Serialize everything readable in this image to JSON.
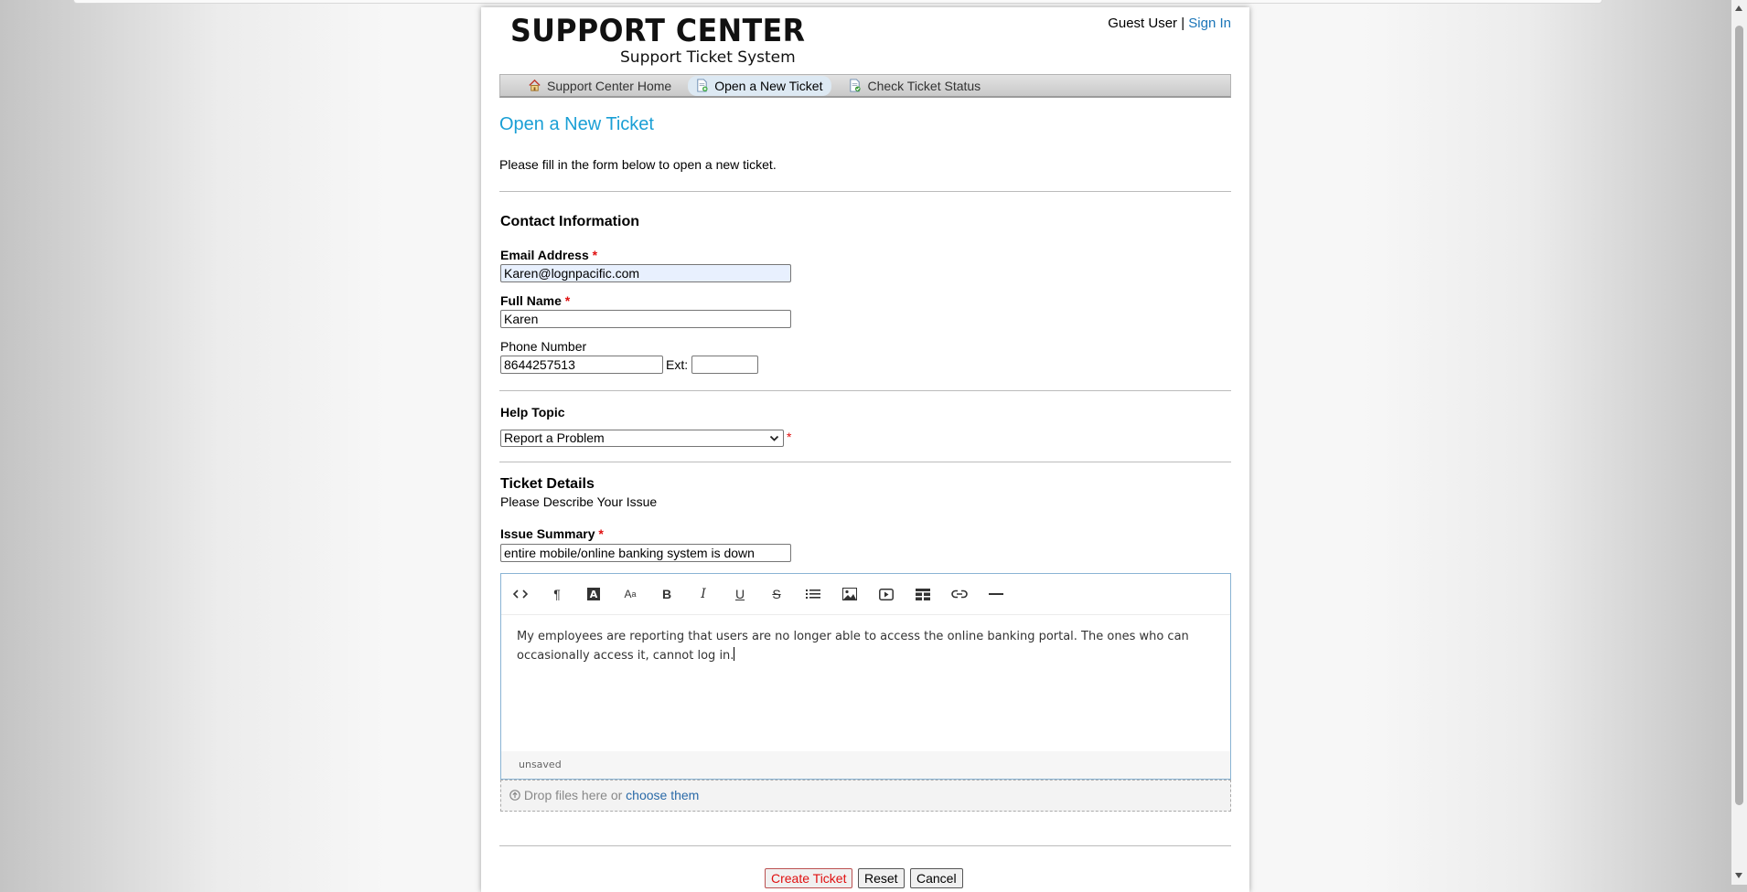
{
  "header": {
    "logo_main": "SUPPORT CENTER",
    "logo_sub": "Support Ticket System",
    "user_label": "Guest User",
    "separator": "|",
    "sign_in": "Sign In"
  },
  "nav": {
    "items": [
      {
        "label": "Support Center Home",
        "icon": "home-icon"
      },
      {
        "label": "Open a New Ticket",
        "icon": "new-ticket-icon"
      },
      {
        "label": "Check Ticket Status",
        "icon": "ticket-status-icon"
      }
    ],
    "active": "Open a New Ticket"
  },
  "page": {
    "title": "Open a New Ticket",
    "intro": "Please fill in the form below to open a new ticket."
  },
  "contact": {
    "title": "Contact Information",
    "email_label": "Email Address",
    "email_value": "Karen@lognpacific.com",
    "name_label": "Full Name",
    "name_value": "Karen",
    "phone_label": "Phone Number",
    "phone_value": "8644257513",
    "ext_label": "Ext:",
    "ext_value": "",
    "required_mark": "*"
  },
  "help_topic": {
    "title": "Help Topic",
    "selected": "Report a Problem"
  },
  "details": {
    "title": "Ticket Details",
    "subtitle": "Please Describe Your Issue",
    "summary_label": "Issue Summary",
    "summary_value": "entire mobile/online banking system is down",
    "body_line1": "My employees are reporting that users are no longer able to access the online banking portal. The ones who can",
    "body_line2": "occasionally access it, cannot log in.",
    "status": "unsaved",
    "toolbar": [
      "code-view-icon",
      "paragraph-icon",
      "text-color-icon",
      "font-size-icon",
      "bold-icon",
      "italic-icon",
      "underline-icon",
      "strikethrough-icon",
      "list-icon",
      "image-icon",
      "video-icon",
      "table-icon",
      "link-icon",
      "horizontal-rule-icon"
    ]
  },
  "attachments": {
    "drop_text": "Drop files here or",
    "choose_link": "choose them"
  },
  "actions": {
    "create": "Create Ticket",
    "reset": "Reset",
    "cancel": "Cancel"
  },
  "colors": {
    "accent": "#1a9fd5",
    "link": "#1a75b8",
    "required": "#e01010"
  }
}
